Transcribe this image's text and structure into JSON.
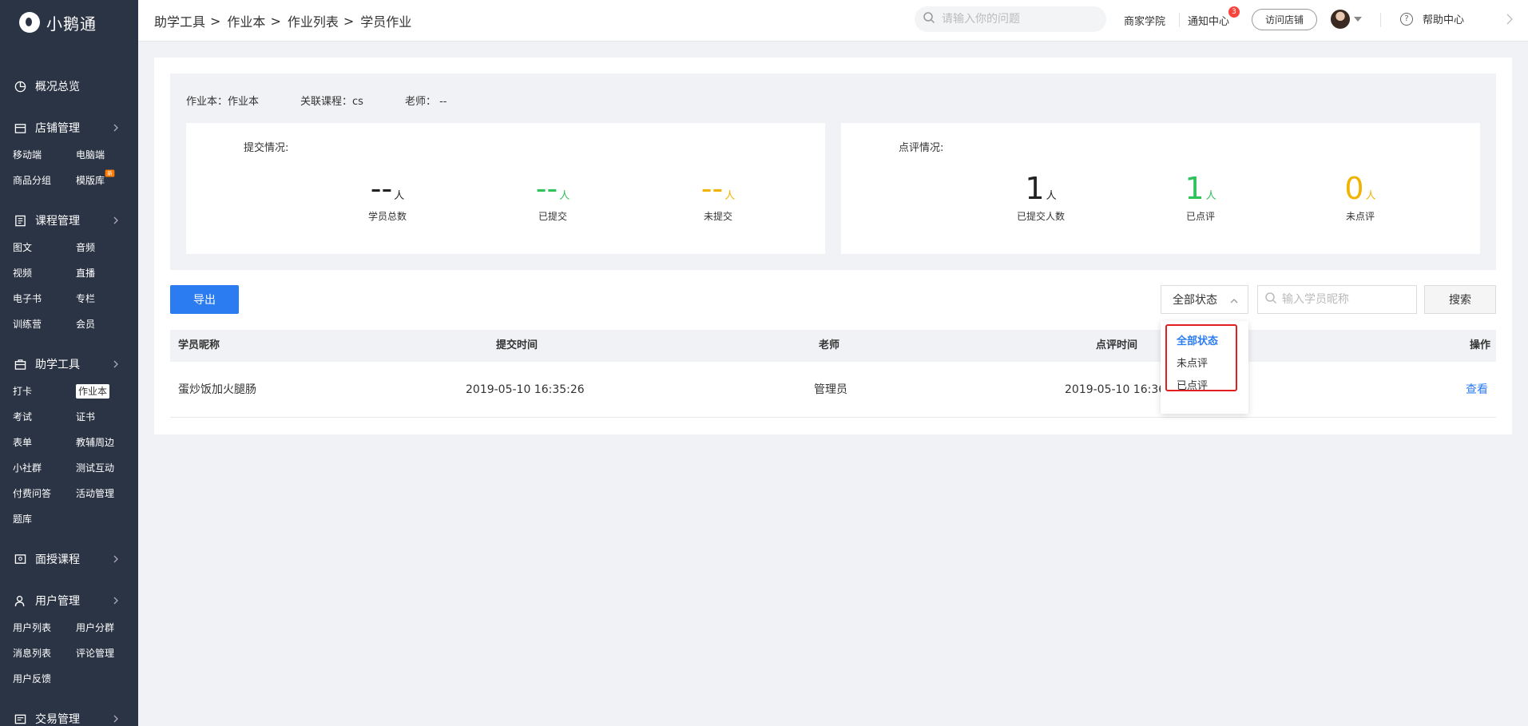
{
  "app": {
    "name": "小鹅通"
  },
  "sidebar": {
    "groups": [
      {
        "label": "概况总览",
        "icon": "dashboard-icon",
        "items": []
      },
      {
        "label": "店铺管理",
        "icon": "store-icon",
        "items": [
          "移动端",
          "电脑端",
          "商品分组",
          "模版库"
        ],
        "badge": "新"
      },
      {
        "label": "课程管理",
        "icon": "course-icon",
        "items": [
          "图文",
          "音频",
          "视频",
          "直播",
          "电子书",
          "专栏",
          "训练营",
          "会员"
        ]
      },
      {
        "label": "助学工具",
        "icon": "toolbox-icon",
        "items": [
          "打卡",
          "作业本",
          "考试",
          "证书",
          "表单",
          "教辅周边",
          "小社群",
          "测试互动",
          "付费问答",
          "活动管理",
          "题库"
        ],
        "active": "作业本"
      },
      {
        "label": "面授课程",
        "icon": "classroom-icon",
        "items": []
      },
      {
        "label": "用户管理",
        "icon": "user-icon",
        "items": [
          "用户列表",
          "用户分群",
          "消息列表",
          "评论管理",
          "用户反馈"
        ]
      },
      {
        "label": "交易管理",
        "icon": "trade-icon",
        "items": []
      }
    ]
  },
  "header": {
    "breadcrumb": [
      "助学工具",
      "作业本",
      "作业列表",
      "学员作业"
    ],
    "breadcrumb_sep": ">",
    "search_placeholder": "请输入你的问题",
    "merchant_academy": "商家学院",
    "notifications": "通知中心",
    "notification_count": "3",
    "visit_store": "访问店铺",
    "help": "帮助中心"
  },
  "info": {
    "homework_book": "作业本：作业本",
    "course": "关联课程：cs",
    "teacher": "老师： --"
  },
  "submission": {
    "title": "提交情况:",
    "stats": [
      {
        "value": "--",
        "unit": "人",
        "label": "学员总数",
        "color": "black"
      },
      {
        "value": "--",
        "unit": "人",
        "label": "已提交",
        "color": "green"
      },
      {
        "value": "--",
        "unit": "人",
        "label": "未提交",
        "color": "orange"
      }
    ]
  },
  "review": {
    "title": "点评情况:",
    "stats": [
      {
        "value": "1",
        "unit": "人",
        "label": "已提交人数",
        "color": "black"
      },
      {
        "value": "1",
        "unit": "人",
        "label": "已点评",
        "color": "green"
      },
      {
        "value": "0",
        "unit": "人",
        "label": "未点评",
        "color": "orange"
      }
    ]
  },
  "toolbar": {
    "export": "导出",
    "status_selected": "全部状态",
    "student_placeholder": "输入学员昵称",
    "search": "搜索"
  },
  "dropdown": {
    "options": [
      "全部状态",
      "未点评",
      "已点评"
    ],
    "selected": "全部状态"
  },
  "table": {
    "headers": [
      "学员昵称",
      "提交时间",
      "老师",
      "点评时间",
      "操作"
    ],
    "rows": [
      {
        "student": "蛋炒饭加火腿肠",
        "submit_time": "2019-05-10 16:35:26",
        "teacher": "管理员",
        "review_time": "2019-05-10 16:36:30",
        "action": "查看"
      }
    ]
  },
  "colors": {
    "sidebar_bg": "#2b3445",
    "primary": "#2b7cf0",
    "green": "#2fc25b",
    "orange": "#f0b400",
    "highlight_border": "#e02020",
    "badge_red": "#f5453d"
  }
}
